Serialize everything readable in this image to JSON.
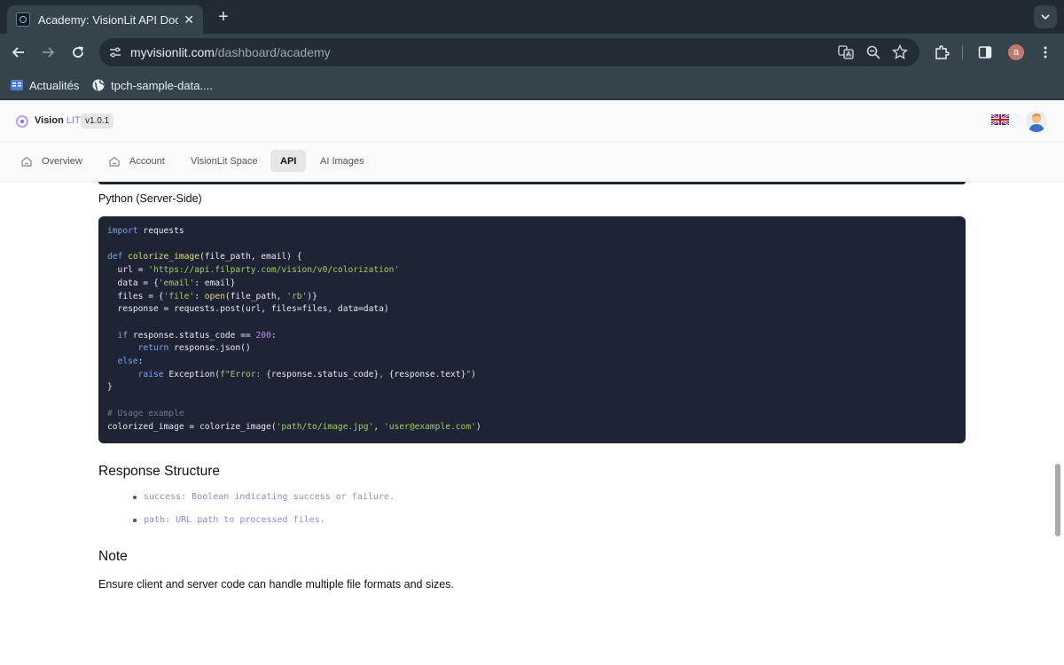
{
  "browser": {
    "tab_title": "Academy: VisionLit API Docum",
    "new_tab_label": "+",
    "url_host": "myvisionlit.com",
    "url_path": "/dashboard/academy",
    "profile_initial": "a",
    "bookmarks": [
      {
        "label": "Actualités",
        "icon": "google-news-icon"
      },
      {
        "label": "tpch-sample-data....",
        "icon": "globe-icon"
      }
    ]
  },
  "app": {
    "brand_name": "Vision",
    "brand_suffix": "LIT",
    "version": "v1.0.1",
    "nav": [
      {
        "label": "Overview",
        "icon": "home-icon"
      },
      {
        "label": "Account",
        "icon": "home-icon"
      },
      {
        "label": "VisionLit Space"
      },
      {
        "label": "API",
        "active": true
      },
      {
        "label": "AI Images"
      }
    ]
  },
  "content": {
    "code_section_label": "Python (Server-Side)",
    "code_lines": [
      "import requests",
      "",
      "def colorize_image(file_path, email) {",
      "  url = 'https://api.filparty.com/vision/v0/colorization'",
      "  data = {'email': email}",
      "  files = {'file': open(file_path, 'rb')}",
      "  response = requests.post(url, files=files, data=data)",
      "",
      "  if response.status_code == 200:",
      "      return response.json()",
      "  else:",
      "      raise Exception(f\"Error: {response.status_code}, {response.text}\")",
      "}",
      "",
      "# Usage example",
      "colorized_image = colorize_image('path/to/image.jpg', 'user@example.com')"
    ],
    "response_heading": "Response Structure",
    "response_items": [
      "success: Boolean indicating success or failure.",
      "path: URL path to processed files."
    ],
    "note_heading": "Note",
    "note_text": "Ensure client and server code can handle multiple file formats and sizes."
  }
}
